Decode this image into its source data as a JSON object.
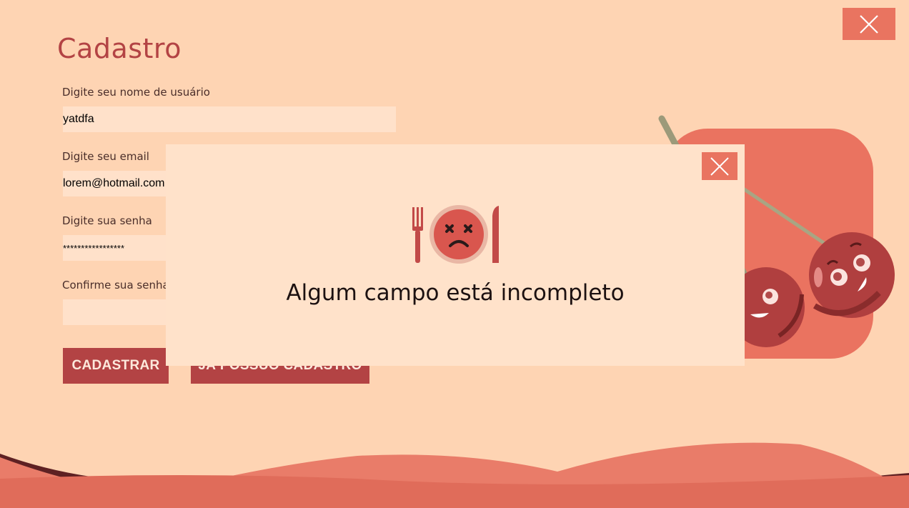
{
  "window": {
    "close_icon": "close-icon"
  },
  "form": {
    "title": "Cadastro",
    "fields": [
      {
        "label": "Digite seu nome de usuário",
        "value": "yatdfa",
        "type": "text"
      },
      {
        "label": "Digite seu email",
        "value": "lorem@hotmail.com",
        "type": "text"
      },
      {
        "label": "Digite sua senha",
        "value": "*****************",
        "type": "password"
      },
      {
        "label": "Confirme sua senha",
        "value": "",
        "type": "password"
      }
    ],
    "buttons": {
      "register": "CADASTRAR",
      "login": "JÁ POSSUO CADASTRO"
    }
  },
  "modal": {
    "message": "Algum campo está incompleto",
    "icon": "sad-plate-icon",
    "close_icon": "close-icon"
  },
  "colors": {
    "background": "#fed4b3",
    "accent": "#b34344",
    "close": "#e97460",
    "modal": "#ffe2ca",
    "input": "#ffe1ca"
  }
}
